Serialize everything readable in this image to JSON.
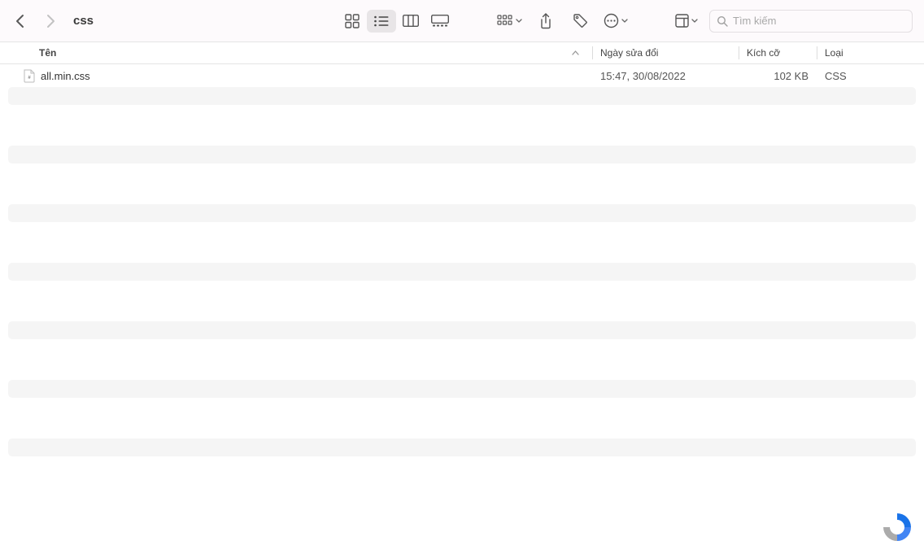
{
  "header": {
    "folder_title": "css"
  },
  "search": {
    "placeholder": "Tìm kiếm"
  },
  "columns": {
    "name": "Tên",
    "modified": "Ngày sửa đổi",
    "size": "Kích cỡ",
    "kind": "Loại"
  },
  "files": [
    {
      "name": "all.min.css",
      "modified": "15:47, 30/08/2022",
      "size": "102 KB",
      "kind": "CSS"
    }
  ],
  "empty_row_count": 13
}
